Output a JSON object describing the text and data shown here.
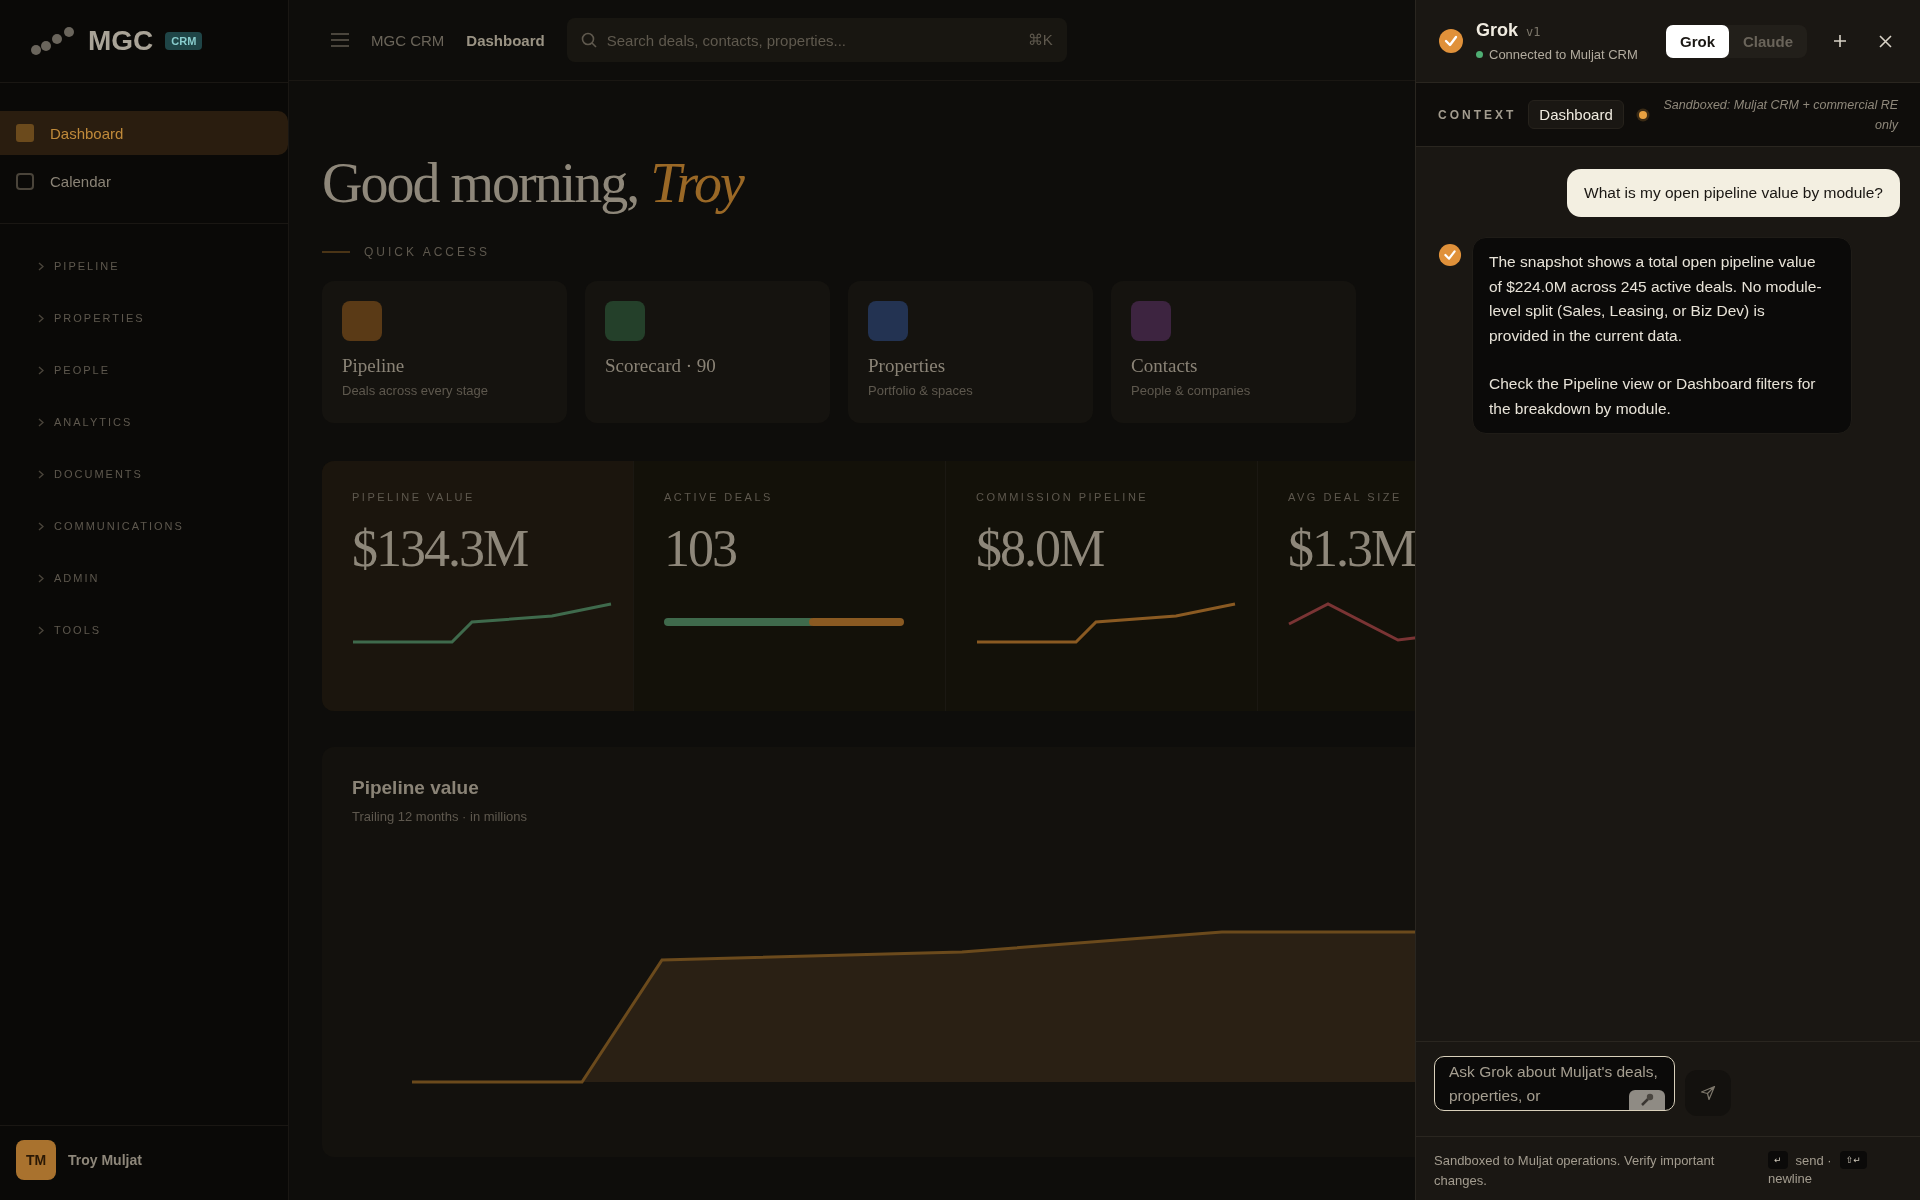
{
  "app": {
    "brand": "MGC",
    "brand_badge": "CRM",
    "nav": [
      {
        "label": "Dashboard",
        "selected": true
      },
      {
        "label": "Calendar",
        "selected": false
      }
    ],
    "nav_groups": [
      "PIPELINE",
      "PROPERTIES",
      "PEOPLE",
      "ANALYTICS",
      "DOCUMENTS",
      "COMMUNICATIONS",
      "ADMIN",
      "TOOLS"
    ],
    "breadcrumb": [
      "MGC CRM",
      "Dashboard"
    ],
    "search": {
      "placeholder": "Search deals, contacts, properties...",
      "shortcut": "⌘K"
    },
    "greeting": "Good morning, ",
    "user_first_name": "Troy",
    "quick_access_label": "QUICK ACCESS",
    "quick_access": [
      {
        "title": "Pipeline",
        "subtitle": "Deals across every stage",
        "color": "#5a3a16"
      },
      {
        "title": "Scorecard · 90",
        "color": "#24402a"
      },
      {
        "title": "Properties",
        "subtitle": "Portfolio & spaces",
        "color": "#233352"
      },
      {
        "title": "Contacts",
        "subtitle": "People & companies",
        "color": "#3d2440"
      }
    ],
    "kpis": [
      {
        "label": "PIPELINE VALUE",
        "value": "$134.3M",
        "kind": "rising"
      },
      {
        "label": "ACTIVE DEALS",
        "value": "103",
        "kind": "split"
      },
      {
        "label": "COMMISSION PIPELINE",
        "value": "$8.0M",
        "kind": "rising"
      },
      {
        "label": "AVG DEAL SIZE",
        "value": "$1.3M",
        "kind": "falling"
      }
    ],
    "chart_title": "Pipeline value",
    "chart_subtitle": "Trailing 12 months · in millions",
    "user": {
      "initials": "TM",
      "name": "Troy Muljat"
    }
  },
  "assistant": {
    "title": "Grok",
    "version": "v1",
    "status": "Connected to Muljat CRM",
    "connected": true,
    "models": [
      {
        "label": "Grok",
        "selected": true
      },
      {
        "label": "Claude",
        "selected": false
      }
    ],
    "context_label": "CONTEXT",
    "context_chip": "Dashboard",
    "sandbox_note": "Sandboxed: Muljat CRM + commercial RE only",
    "messages": [
      {
        "kind": "user",
        "text": "What is my open pipeline value by module?"
      },
      {
        "kind": "reply",
        "paragraphs": [
          "The snapshot shows a total open pipeline value of $224.0M across 245 active deals. No module-level split (Sales, Leasing, or Biz Dev) is provided in the current data.",
          "Check the Pipeline view or Dashboard filters for the breakdown by module."
        ]
      }
    ],
    "input": {
      "placeholder": "Ask Grok about Muljat's deals, properties, or"
    },
    "footer_note": "Sandboxed to Muljat operations. Verify important changes.",
    "shortcuts": [
      {
        "key": "↵",
        "label": "send ·"
      },
      {
        "key": "⇧↵",
        "label": "newline"
      }
    ]
  }
}
